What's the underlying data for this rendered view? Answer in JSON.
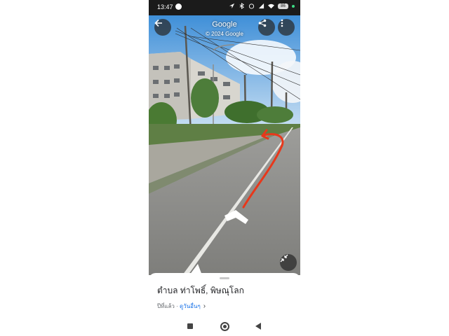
{
  "status_bar": {
    "time": "13:47",
    "battery": "86"
  },
  "street_view": {
    "title": "Google",
    "copyright": "© 2024 Google"
  },
  "place": {
    "name": "ตำบล ท่าโพธิ์, พิษณุโลก",
    "captured": "ปีที่แล้ว · ",
    "see_more": "ดูวันอื่นๆ"
  },
  "colors": {
    "annotation_arrow": "#e8381b",
    "link": "#1a73e8"
  },
  "icons": {
    "back": "arrow-left-icon",
    "share": "share-icon",
    "more": "more-vert-icon",
    "collapse": "collapse-icon"
  }
}
